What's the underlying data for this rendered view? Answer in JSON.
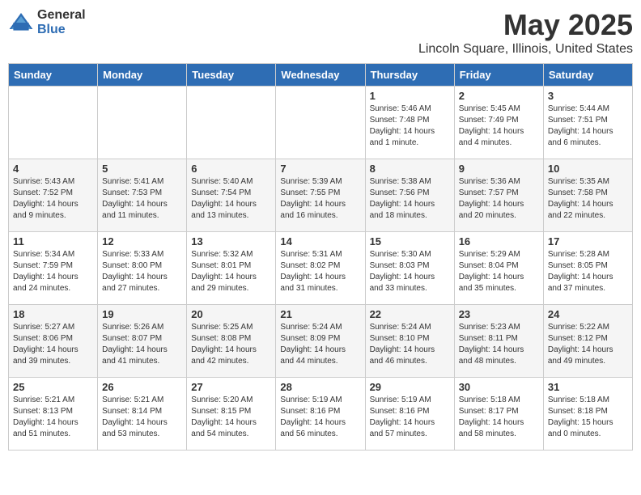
{
  "header": {
    "logo_general": "General",
    "logo_blue": "Blue",
    "title": "May 2025",
    "subtitle": "Lincoln Square, Illinois, United States"
  },
  "days_of_week": [
    "Sunday",
    "Monday",
    "Tuesday",
    "Wednesday",
    "Thursday",
    "Friday",
    "Saturday"
  ],
  "weeks": [
    [
      {
        "date": "",
        "info": ""
      },
      {
        "date": "",
        "info": ""
      },
      {
        "date": "",
        "info": ""
      },
      {
        "date": "",
        "info": ""
      },
      {
        "date": "1",
        "info": "Sunrise: 5:46 AM\nSunset: 7:48 PM\nDaylight: 14 hours and 1 minute."
      },
      {
        "date": "2",
        "info": "Sunrise: 5:45 AM\nSunset: 7:49 PM\nDaylight: 14 hours and 4 minutes."
      },
      {
        "date": "3",
        "info": "Sunrise: 5:44 AM\nSunset: 7:51 PM\nDaylight: 14 hours and 6 minutes."
      }
    ],
    [
      {
        "date": "4",
        "info": "Sunrise: 5:43 AM\nSunset: 7:52 PM\nDaylight: 14 hours and 9 minutes."
      },
      {
        "date": "5",
        "info": "Sunrise: 5:41 AM\nSunset: 7:53 PM\nDaylight: 14 hours and 11 minutes."
      },
      {
        "date": "6",
        "info": "Sunrise: 5:40 AM\nSunset: 7:54 PM\nDaylight: 14 hours and 13 minutes."
      },
      {
        "date": "7",
        "info": "Sunrise: 5:39 AM\nSunset: 7:55 PM\nDaylight: 14 hours and 16 minutes."
      },
      {
        "date": "8",
        "info": "Sunrise: 5:38 AM\nSunset: 7:56 PM\nDaylight: 14 hours and 18 minutes."
      },
      {
        "date": "9",
        "info": "Sunrise: 5:36 AM\nSunset: 7:57 PM\nDaylight: 14 hours and 20 minutes."
      },
      {
        "date": "10",
        "info": "Sunrise: 5:35 AM\nSunset: 7:58 PM\nDaylight: 14 hours and 22 minutes."
      }
    ],
    [
      {
        "date": "11",
        "info": "Sunrise: 5:34 AM\nSunset: 7:59 PM\nDaylight: 14 hours and 24 minutes."
      },
      {
        "date": "12",
        "info": "Sunrise: 5:33 AM\nSunset: 8:00 PM\nDaylight: 14 hours and 27 minutes."
      },
      {
        "date": "13",
        "info": "Sunrise: 5:32 AM\nSunset: 8:01 PM\nDaylight: 14 hours and 29 minutes."
      },
      {
        "date": "14",
        "info": "Sunrise: 5:31 AM\nSunset: 8:02 PM\nDaylight: 14 hours and 31 minutes."
      },
      {
        "date": "15",
        "info": "Sunrise: 5:30 AM\nSunset: 8:03 PM\nDaylight: 14 hours and 33 minutes."
      },
      {
        "date": "16",
        "info": "Sunrise: 5:29 AM\nSunset: 8:04 PM\nDaylight: 14 hours and 35 minutes."
      },
      {
        "date": "17",
        "info": "Sunrise: 5:28 AM\nSunset: 8:05 PM\nDaylight: 14 hours and 37 minutes."
      }
    ],
    [
      {
        "date": "18",
        "info": "Sunrise: 5:27 AM\nSunset: 8:06 PM\nDaylight: 14 hours and 39 minutes."
      },
      {
        "date": "19",
        "info": "Sunrise: 5:26 AM\nSunset: 8:07 PM\nDaylight: 14 hours and 41 minutes."
      },
      {
        "date": "20",
        "info": "Sunrise: 5:25 AM\nSunset: 8:08 PM\nDaylight: 14 hours and 42 minutes."
      },
      {
        "date": "21",
        "info": "Sunrise: 5:24 AM\nSunset: 8:09 PM\nDaylight: 14 hours and 44 minutes."
      },
      {
        "date": "22",
        "info": "Sunrise: 5:24 AM\nSunset: 8:10 PM\nDaylight: 14 hours and 46 minutes."
      },
      {
        "date": "23",
        "info": "Sunrise: 5:23 AM\nSunset: 8:11 PM\nDaylight: 14 hours and 48 minutes."
      },
      {
        "date": "24",
        "info": "Sunrise: 5:22 AM\nSunset: 8:12 PM\nDaylight: 14 hours and 49 minutes."
      }
    ],
    [
      {
        "date": "25",
        "info": "Sunrise: 5:21 AM\nSunset: 8:13 PM\nDaylight: 14 hours and 51 minutes."
      },
      {
        "date": "26",
        "info": "Sunrise: 5:21 AM\nSunset: 8:14 PM\nDaylight: 14 hours and 53 minutes."
      },
      {
        "date": "27",
        "info": "Sunrise: 5:20 AM\nSunset: 8:15 PM\nDaylight: 14 hours and 54 minutes."
      },
      {
        "date": "28",
        "info": "Sunrise: 5:19 AM\nSunset: 8:16 PM\nDaylight: 14 hours and 56 minutes."
      },
      {
        "date": "29",
        "info": "Sunrise: 5:19 AM\nSunset: 8:16 PM\nDaylight: 14 hours and 57 minutes."
      },
      {
        "date": "30",
        "info": "Sunrise: 5:18 AM\nSunset: 8:17 PM\nDaylight: 14 hours and 58 minutes."
      },
      {
        "date": "31",
        "info": "Sunrise: 5:18 AM\nSunset: 8:18 PM\nDaylight: 15 hours and 0 minutes."
      }
    ]
  ]
}
